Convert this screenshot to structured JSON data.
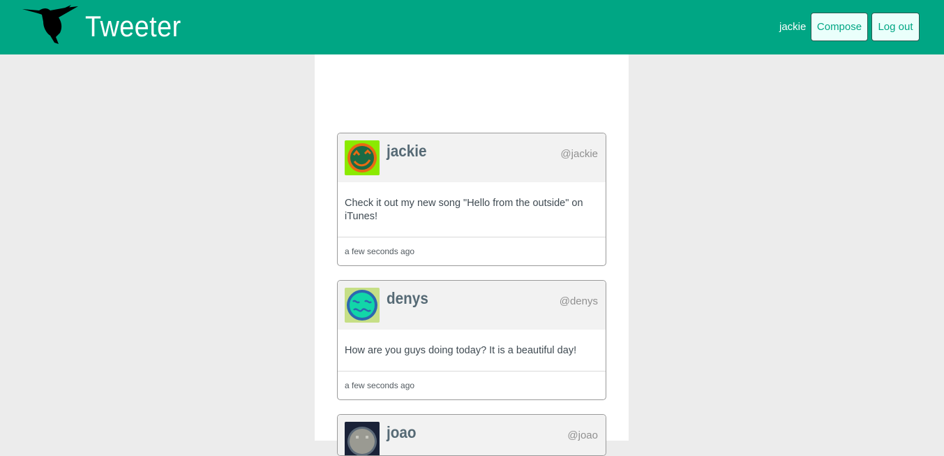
{
  "header": {
    "brand": "Tweeter",
    "username": "jackie",
    "compose_label": "Compose",
    "logout_label": "Log out",
    "logo_icon": "hummingbird-icon",
    "colors": {
      "accent": "#00a684",
      "button_bg": "#eafffb"
    }
  },
  "tweets": [
    {
      "name": "jackie",
      "handle": "@jackie",
      "text": "Check it out my new song \"Hello from the outside\" on iTunes!",
      "time": "a few seconds ago",
      "avatar_icon": "winking-face-avatar-icon",
      "avatar_colors": {
        "bg": "#8bea00",
        "face": "#1b6b44",
        "ring": "#e86a14"
      }
    },
    {
      "name": "denys",
      "handle": "@denys",
      "text": "How are you guys doing today? It is a beautiful day!",
      "time": "a few seconds ago",
      "avatar_icon": "wavy-face-avatar-icon",
      "avatar_colors": {
        "bg": "#c6df86",
        "face": "#12d6a8",
        "ring": "#2d68b0"
      }
    },
    {
      "name": "joao",
      "handle": "@joao",
      "avatar_icon": "robot-face-avatar-icon",
      "avatar_colors": {
        "bg": "#1a2238",
        "face": "#9a9a92"
      }
    }
  ]
}
